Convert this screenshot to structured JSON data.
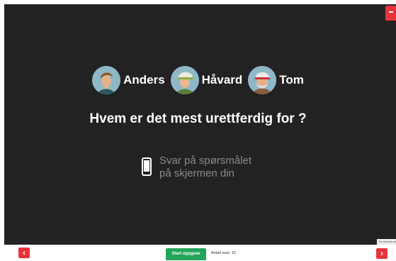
{
  "characters": [
    {
      "name": "Anders",
      "icon": "man-with-hair-avatar-icon"
    },
    {
      "name": "Håvard",
      "icon": "man-with-cap-avatar-icon"
    },
    {
      "name": "Tom",
      "icon": "old-man-with-cap-avatar-icon"
    }
  ],
  "question": "Hvem er det mest urettferdig for ?",
  "answer_prompt": {
    "line1": "Svar på spørsmålet",
    "line2": "på skjermen din",
    "icon": "phone-icon"
  },
  "controls": {
    "prev_icon": "‹",
    "next_icon": "›",
    "start_label": "Start oppgave",
    "answer_count": "Antall svar: 16",
    "tooltip": "Vis skrivebord",
    "menu_icon": "menu-icon"
  },
  "colors": {
    "stage_bg": "#222222",
    "accent_red": "#e7343c",
    "start_green": "#23a45a"
  }
}
